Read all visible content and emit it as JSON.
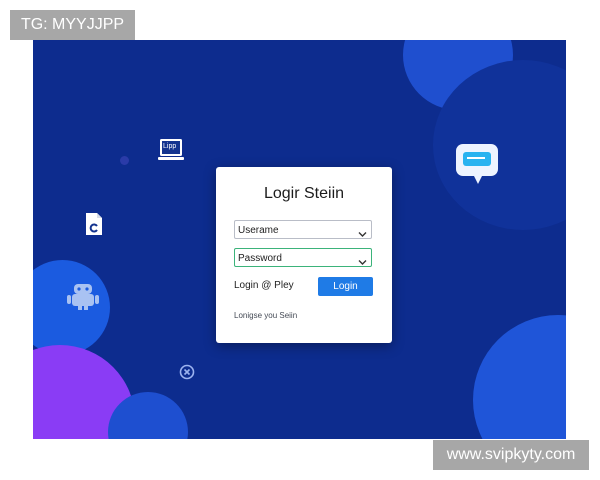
{
  "watermarks": {
    "top_left": "TG: MYYJJPP",
    "bottom_right": "www.svipkyty.com"
  },
  "floating_icons": {
    "window_label": "Lipp",
    "icons": [
      "laptop-icon",
      "document-icon",
      "chat-bubble-icon",
      "robot-icon",
      "close-circle-icon"
    ]
  },
  "login_card": {
    "title": "Logir Steiin",
    "username_value": "Userame",
    "password_value": "Password",
    "link_text": "Login @ Pley",
    "login_button": "Login",
    "footnote": "Lonigse you Seiin"
  },
  "colors": {
    "background": "#0d2c8e",
    "button": "#1f7be6",
    "focus_border": "#3bb37a",
    "accent_purple": "#8a3cf5"
  }
}
